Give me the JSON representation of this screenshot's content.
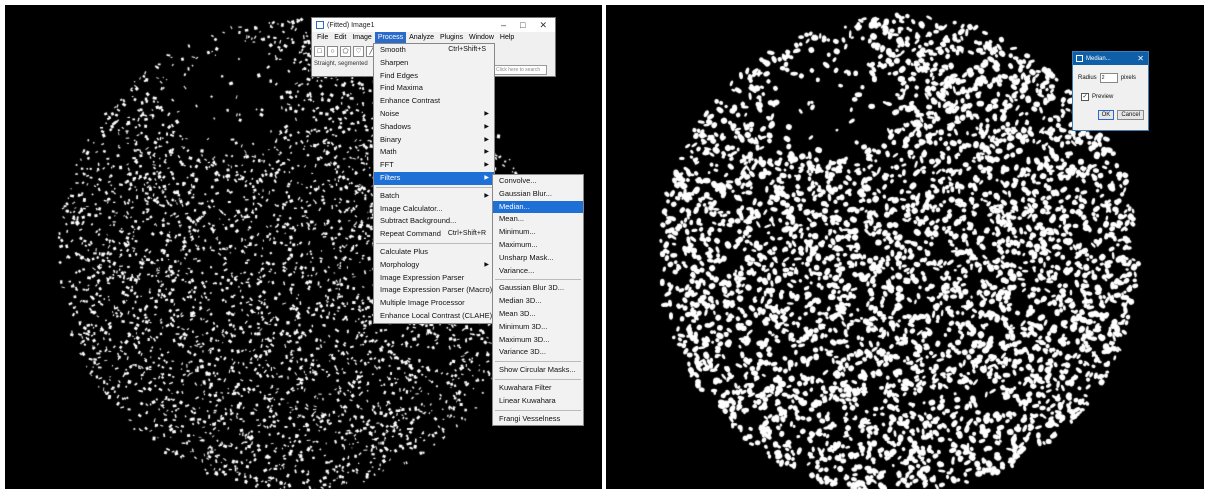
{
  "imagej_window": {
    "title": "(Fitted) Image1",
    "window_buttons": [
      "–",
      "□",
      "✕"
    ],
    "menubar": [
      "File",
      "Edit",
      "Image",
      "Process",
      "Analyze",
      "Plugins",
      "Window",
      "Help"
    ],
    "active_menu": "Process",
    "toolbar_icons": [
      "rectangle-tool-icon",
      "oval-tool-icon",
      "polygon-tool-icon",
      "freehand-tool-icon",
      "straight-line-tool-icon",
      "angle-tool-icon",
      "point-tool-icon",
      "wand-tool-icon",
      "text-tool-icon",
      "magnify-tool-icon",
      "dropper-tool-icon",
      "more-tools-icon"
    ],
    "status_text": "Straight, segmented",
    "search_placeholder": "Click here to search"
  },
  "process_menu": {
    "items": [
      {
        "label": "Smooth",
        "shortcut": "Ctrl+Shift+S"
      },
      {
        "label": "Sharpen"
      },
      {
        "label": "Find Edges"
      },
      {
        "label": "Find Maxima"
      },
      {
        "label": "Enhance Contrast"
      },
      {
        "label": "Noise",
        "submenu": true
      },
      {
        "label": "Shadows",
        "submenu": true
      },
      {
        "label": "Binary",
        "submenu": true
      },
      {
        "label": "Math",
        "submenu": true
      },
      {
        "label": "FFT",
        "submenu": true
      },
      {
        "label": "Filters",
        "submenu": true,
        "highlighted": true
      },
      {
        "separator": true
      },
      {
        "label": "Batch",
        "submenu": true
      },
      {
        "label": "Image Calculator..."
      },
      {
        "label": "Subtract Background..."
      },
      {
        "label": "Repeat Command",
        "shortcut": "Ctrl+Shift+R"
      },
      {
        "separator": true
      },
      {
        "label": "Calculate Plus"
      },
      {
        "label": "Morphology",
        "submenu": true
      },
      {
        "label": "Image Expression Parser"
      },
      {
        "label": "Image Expression Parser (Macro)"
      },
      {
        "label": "Multiple Image Processor"
      },
      {
        "label": "Enhance Local Contrast (CLAHE)"
      }
    ]
  },
  "filters_menu": {
    "items": [
      {
        "label": "Convolve..."
      },
      {
        "label": "Gaussian Blur..."
      },
      {
        "label": "Median...",
        "highlighted": true
      },
      {
        "label": "Mean..."
      },
      {
        "label": "Minimum..."
      },
      {
        "label": "Maximum..."
      },
      {
        "label": "Unsharp Mask..."
      },
      {
        "label": "Variance..."
      },
      {
        "separator": true
      },
      {
        "label": "Gaussian Blur 3D..."
      },
      {
        "label": "Median 3D..."
      },
      {
        "label": "Mean 3D..."
      },
      {
        "label": "Minimum 3D..."
      },
      {
        "label": "Maximum 3D..."
      },
      {
        "label": "Variance 3D..."
      },
      {
        "separator": true
      },
      {
        "label": "Show Circular Masks..."
      },
      {
        "separator": true
      },
      {
        "label": "Kuwahara Filter"
      },
      {
        "label": "Linear Kuwahara"
      },
      {
        "separator": true
      },
      {
        "label": "Frangi Vesselness"
      }
    ]
  },
  "median_dialog": {
    "title": "Median...",
    "radius_label": "Radius",
    "radius_value": "2",
    "radius_unit": "pixels",
    "preview_label": "Preview",
    "preview_checked": true,
    "ok_label": "OK",
    "cancel_label": "Cancel"
  },
  "colors": {
    "background": "#000000",
    "particles": "#ffffff",
    "menu_highlight": "#1e6fd6",
    "dialog_title": "#0f5fa8"
  }
}
